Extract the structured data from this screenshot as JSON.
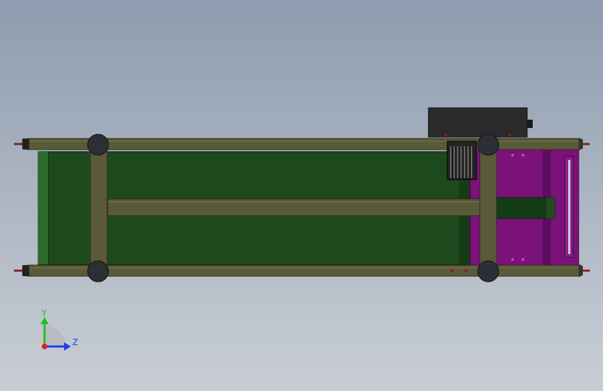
{
  "viewport": {
    "view_orientation": "top",
    "colors": {
      "background_top": "#8d9caf",
      "background_bottom": "#c9ced5",
      "frame": "#5a5a3a",
      "frame_dark": "#2e2e1c",
      "belt": "#1c4a1c",
      "belt_dark": "#0f2f0f",
      "drive_plate": "#7a127a",
      "motor_box": "#2a2a2a",
      "foot": "#2c2f33"
    }
  },
  "triad": {
    "y_label": "Y",
    "z_label": "Z",
    "y_color": "#1fbf1f",
    "z_color": "#1f3fe0",
    "origin_color": "#e01f1f"
  }
}
